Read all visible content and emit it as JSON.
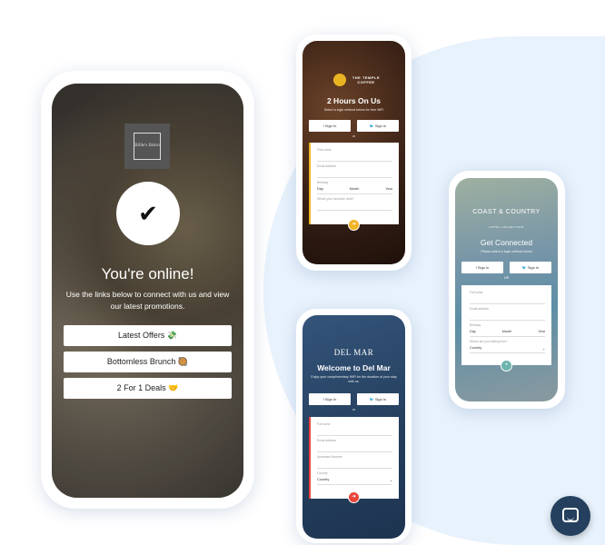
{
  "bistro": {
    "logo": "Billie's Bistro",
    "title": "You're online!",
    "subtitle": "Use the links below to connect with us and view our latest promotions.",
    "buttons": [
      "Latest Offers 💸",
      "Bottomless Brunch 🥘",
      "2 For 1 Deals 🤝"
    ]
  },
  "coffee": {
    "logo": "THE TEMPLE COFFEE",
    "title": "2 Hours On Us",
    "subtitle": "Select a login method below for free WiFi",
    "facebook": "Sign In",
    "twitter": "Sign In",
    "or": "or",
    "fields": [
      "First name",
      "Email address"
    ],
    "birthday_label": "Birthday",
    "day": "Day",
    "month": "Month",
    "year": "Year",
    "extra": "What's your favourite drink?",
    "accent": "#f0b323"
  },
  "delmar": {
    "logo": "DEL MAR",
    "title": "Welcome to Del Mar",
    "subtitle": "Enjoy your complimentary WiFi for the duration of your stay with us.",
    "facebook": "Sign In",
    "twitter": "Sign In",
    "or": "or",
    "fields": [
      "Full name",
      "Email address",
      "Apartment Number"
    ],
    "country_label": "Country",
    "country": "Country",
    "accent": "#e8453c"
  },
  "coast": {
    "logo": "COAST & COUNTRY",
    "logo_sub": "HOTEL COLLECTION",
    "title": "Get Connected",
    "subtitle": "Please select a login method below",
    "facebook": "Sign In",
    "twitter": "Sign In",
    "or": "OR",
    "fields": [
      "Full name",
      "Email address"
    ],
    "birthday_label": "Birthday",
    "day": "Day",
    "month": "Month",
    "year": "Year",
    "country_label": "Where are you visiting from?",
    "country": "Country",
    "accent": "#6fb3ad"
  },
  "chat": {
    "icon": "chat-icon",
    "color": "#24405e"
  }
}
